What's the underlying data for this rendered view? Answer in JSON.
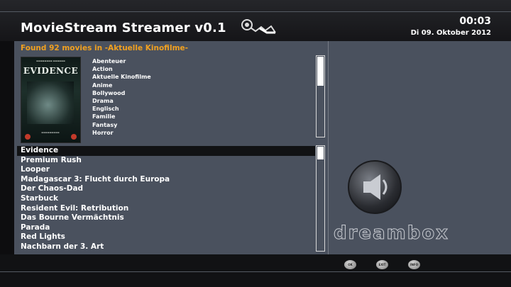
{
  "header": {
    "title": "MovieStream Streamer v0.1",
    "clock": "00:03",
    "date": "Di 09. Oktober 2012"
  },
  "list_header": "Found 92 movies in -Aktuelle Kinofilme-",
  "poster": {
    "title": "EVIDENCE",
    "logo_icon": "satellite-dish-icon"
  },
  "genres": [
    "Abenteuer",
    "Action",
    "Aktuelle Kinofilme",
    "Anime",
    "Bollywood",
    "Drama",
    "Englisch",
    "Familie",
    "Fantasy",
    "Horror"
  ],
  "genre_scroll_fraction": 0.36,
  "movies": [
    "Evidence",
    "Premium Rush",
    "Looper",
    "Madagascar 3: Flucht durch Europa",
    "Der Chaos-Dad",
    "Starbuck",
    "Resident Evil: Retribution",
    "Das Bourne Vermächtnis",
    "Parada",
    "Red Lights",
    "Nachbarn der 3. Art"
  ],
  "selected_index": 0,
  "movie_scroll_fraction": 0.12,
  "brand": "dreambox",
  "buttons": [
    {
      "label": "OK",
      "icon": "ok-button-icon"
    },
    {
      "label": "EXIT",
      "icon": "exit-button-icon"
    },
    {
      "label": "INFO",
      "icon": "info-button-icon"
    }
  ],
  "colors": {
    "accent": "#f0a020",
    "panel": "#4a515e",
    "selection": "#111214"
  }
}
